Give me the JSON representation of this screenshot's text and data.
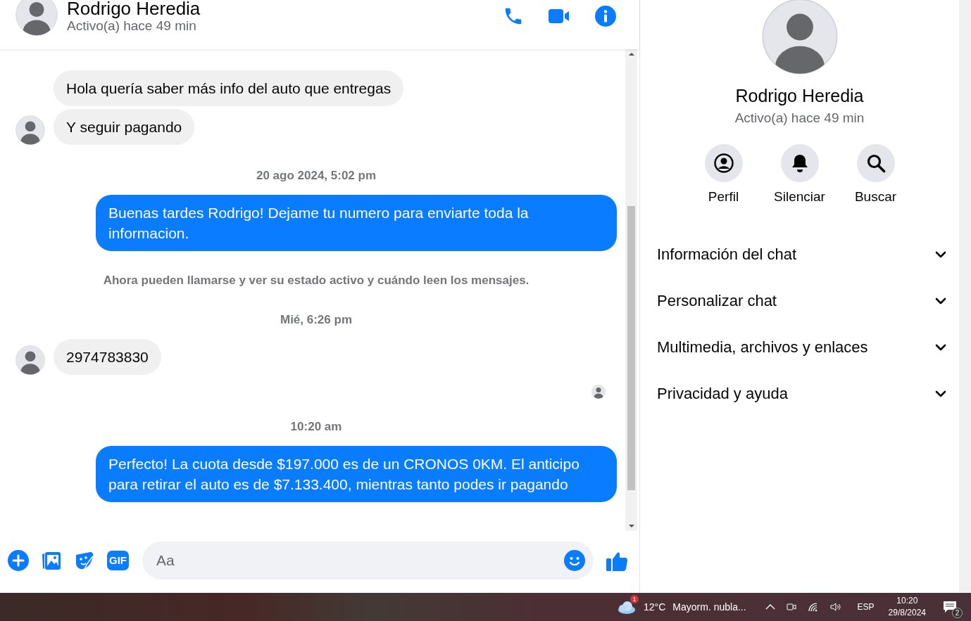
{
  "chat_header": {
    "name": "Rodrigo Heredia",
    "status": "Activo(a) hace 49 min"
  },
  "messages": [
    {
      "kind": "incoming",
      "text": "Hola quería saber más info del auto que entregas",
      "show_avatar": false
    },
    {
      "kind": "incoming",
      "text": "Y seguir pagando",
      "show_avatar": true
    },
    {
      "kind": "timestamp",
      "text": "20 ago 2024, 5:02 pm"
    },
    {
      "kind": "outgoing",
      "text": "Buenas tardes Rodrigo! Dejame tu numero para enviarte toda la informacion."
    },
    {
      "kind": "notice",
      "text": "Ahora pueden llamarse y ver su estado activo y cuándo leen los mensajes."
    },
    {
      "kind": "timestamp",
      "text": "Mié, 6:26 pm"
    },
    {
      "kind": "incoming",
      "text": "2974783830",
      "show_avatar": true
    },
    {
      "kind": "read_receipt"
    },
    {
      "kind": "timestamp",
      "text": "10:20 am"
    },
    {
      "kind": "outgoing",
      "text": "Perfecto! La cuota desde $197.000 es de un CRONOS 0KM. El anticipo para retirar el auto es de $7.133.400, mientras tanto podes ir pagando"
    }
  ],
  "composer": {
    "gif_label": "GIF",
    "placeholder": "Aa"
  },
  "profile": {
    "name": "Rodrigo Heredia",
    "status": "Activo(a) hace 49 min",
    "actions": [
      {
        "kind": "profile",
        "label": "Perfil"
      },
      {
        "kind": "mute",
        "label": "Silenciar"
      },
      {
        "kind": "search",
        "label": "Buscar"
      }
    ],
    "sections": [
      {
        "title": "Información del chat",
        "expanded": false
      },
      {
        "title": "Personalizar chat",
        "expanded": false
      },
      {
        "title": "Multimedia, archivos y enlaces",
        "expanded": false
      },
      {
        "title": "Privacidad y ayuda",
        "expanded": false
      }
    ]
  },
  "taskbar": {
    "weather_badge": "1",
    "temperature": "12°C",
    "weather": "Mayorm. nubla...",
    "language": "ESP",
    "time": "10:20",
    "date": "29/8/2024",
    "notification_count": "2"
  }
}
